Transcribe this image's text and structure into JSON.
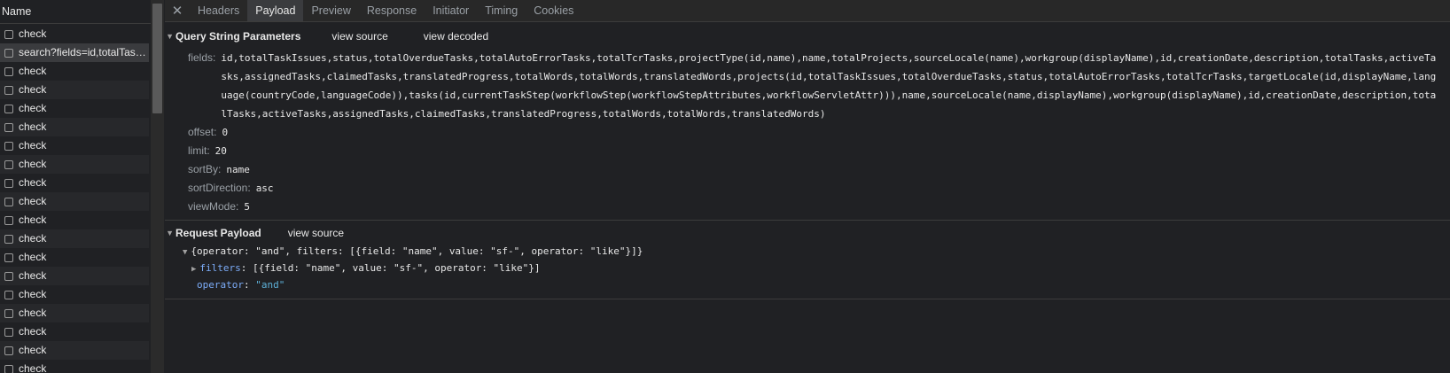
{
  "left_panel": {
    "header": "Name",
    "requests": [
      {
        "name": "check"
      },
      {
        "name": "search?fields=id,totalTaskIssues,status,totalOverdueTasks"
      },
      {
        "name": "check"
      },
      {
        "name": "check"
      },
      {
        "name": "check"
      },
      {
        "name": "check"
      },
      {
        "name": "check"
      },
      {
        "name": "check"
      },
      {
        "name": "check"
      },
      {
        "name": "check"
      },
      {
        "name": "check"
      },
      {
        "name": "check"
      },
      {
        "name": "check"
      },
      {
        "name": "check"
      },
      {
        "name": "check"
      },
      {
        "name": "check"
      },
      {
        "name": "check"
      },
      {
        "name": "check"
      },
      {
        "name": "check"
      }
    ]
  },
  "tabs": [
    "Headers",
    "Payload",
    "Preview",
    "Response",
    "Initiator",
    "Timing",
    "Cookies"
  ],
  "active_tab": "Payload",
  "query_section": {
    "title": "Query String Parameters",
    "link1": "view source",
    "link2": "view decoded",
    "params": [
      {
        "key": "fields:",
        "value": "id,totalTaskIssues,status,totalOverdueTasks,totalAutoErrorTasks,totalTcrTasks,projectType(id,name),name,totalProjects,sourceLocale(name),workgroup(displayName),id,creationDate,description,totalTasks,activeTasks,assignedTasks,claimedTasks,translatedProgress,totalWords,totalWords,translatedWords,projects(id,totalTaskIssues,totalOverdueTasks,status,totalAutoErrorTasks,totalTcrTasks,targetLocale(id,displayName,language(countryCode,languageCode)),tasks(id,currentTaskStep(workflowStep(workflowStepAttributes,workflowServletAttr))),name,sourceLocale(name,displayName),workgroup(displayName),id,creationDate,description,totalTasks,activeTasks,assignedTasks,claimedTasks,translatedProgress,totalWords,totalWords,translatedWords)"
      },
      {
        "key": "offset:",
        "value": "0"
      },
      {
        "key": "limit:",
        "value": "20"
      },
      {
        "key": "sortBy:",
        "value": "name"
      },
      {
        "key": "sortDirection:",
        "value": "asc"
      },
      {
        "key": "viewMode:",
        "value": "5"
      }
    ]
  },
  "payload_section": {
    "title": "Request Payload",
    "link": "view source",
    "summary": "{operator: \"and\", filters: [{field: \"name\", value: \"sf-\", operator: \"like\"}]}",
    "filters_key": "filters",
    "filters_value": "[{field: \"name\", value: \"sf-\", operator: \"like\"}]",
    "operator_key": "operator",
    "operator_value": "\"and\""
  }
}
